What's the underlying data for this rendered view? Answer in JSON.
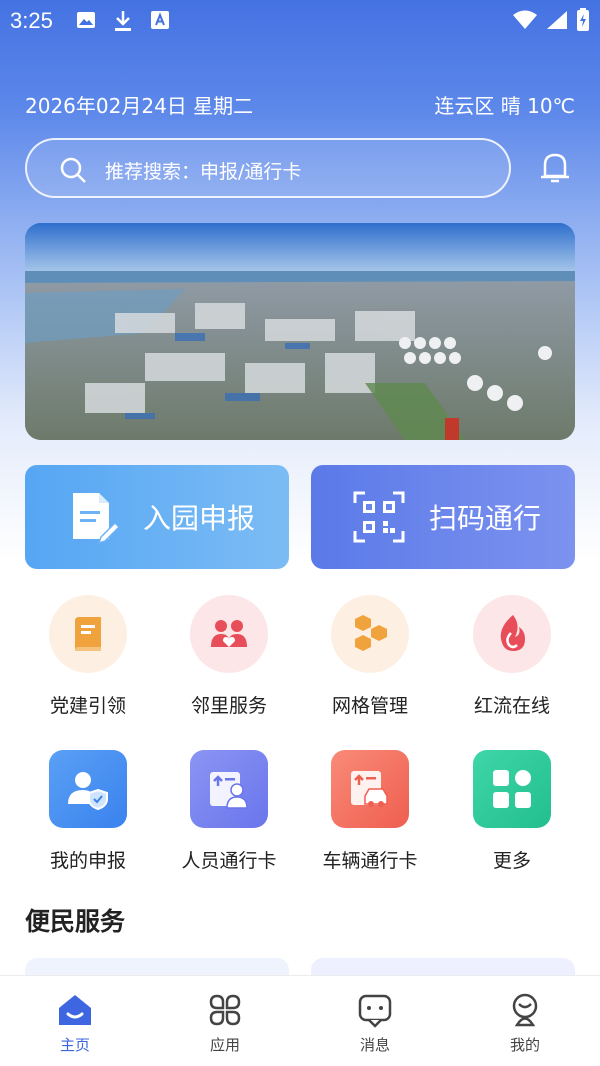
{
  "status_bar": {
    "time": "3:25"
  },
  "header": {
    "date": "2026年02月24日  星期二",
    "weather": "连云区 晴 10℃"
  },
  "search": {
    "placeholder": "推荐搜索：申报/通行卡"
  },
  "primary_actions": [
    {
      "label": "入园申报"
    },
    {
      "label": "扫码通行"
    }
  ],
  "services_row1": [
    {
      "label": "党建引领",
      "icon": "book-icon",
      "color": "#f0a33c"
    },
    {
      "label": "邻里服务",
      "icon": "people-heart-icon",
      "color": "#e84e5a"
    },
    {
      "label": "网格管理",
      "icon": "hexagon-grid-icon",
      "color": "#f0a33c"
    },
    {
      "label": "红流在线",
      "icon": "flame-icon",
      "color": "#e84e5a"
    }
  ],
  "services_row2": [
    {
      "label": "我的申报",
      "icon": "user-shield-icon",
      "color": "#4a90f0"
    },
    {
      "label": "人员通行卡",
      "icon": "person-card-icon",
      "color": "#7b86f0"
    },
    {
      "label": "车辆通行卡",
      "icon": "car-card-icon",
      "color": "#f26a5a"
    },
    {
      "label": "更多",
      "icon": "grid-more-icon",
      "color": "#2ec79a"
    }
  ],
  "section": {
    "title": "便民服务"
  },
  "tab_bar": [
    {
      "label": "主页",
      "icon": "home-icon",
      "active": true
    },
    {
      "label": "应用",
      "icon": "apps-icon",
      "active": false
    },
    {
      "label": "消息",
      "icon": "message-icon",
      "active": false
    },
    {
      "label": "我的",
      "icon": "profile-icon",
      "active": false
    }
  ],
  "colors": {
    "accent": "#3d66e0",
    "header_top": "#4472e2"
  }
}
